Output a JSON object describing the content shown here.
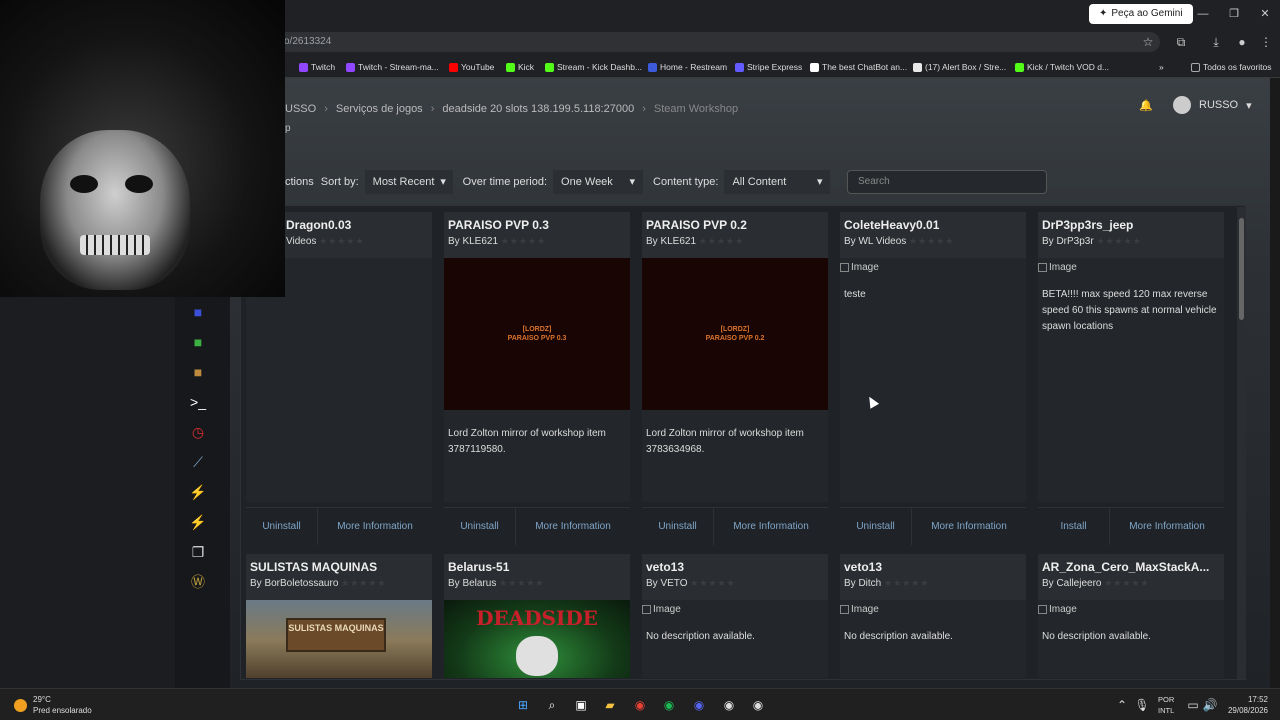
{
  "browser": {
    "gemini_button": "Peça ao Gemini",
    "address": "o/2613324",
    "bookmarks": [
      "Twitch",
      "Twitch - Stream-ma...",
      "YouTube",
      "Kick",
      "Stream - Kick Dashb...",
      "Home - Restream",
      "Stripe Express",
      "The best ChatBot an...",
      "(17) Alert Box / Stre...",
      "Kick / Twitch VOD d..."
    ],
    "bookmark_colors": [
      "#9146ff",
      "#9146ff",
      "#ff0000",
      "#53fc18",
      "#53fc18",
      "#3b5bdb",
      "#635bff",
      "#ffffff",
      "#e8e8e8",
      "#53fc18"
    ],
    "all_favorites": "Todos os favoritos",
    "chevron_more": "»"
  },
  "header": {
    "breadcrumb": [
      "USSO",
      "Serviços de jogos",
      "deadside 20 slots 138.199.5.118:27000",
      "Steam Workshop"
    ],
    "subtitle": "p",
    "user": "RUSSO"
  },
  "filters": {
    "lead": "ctions",
    "sort_label": "Sort by:",
    "sort_value": "Most Recent",
    "period_label": "Over time period:",
    "period_value": "One Week",
    "content_label": "Content type:",
    "content_value": "All Content",
    "search_placeholder": "Search"
  },
  "cards_row1": [
    {
      "title": "Dragon0.03",
      "by": "Videos",
      "desc": "",
      "primary": "Uninstall",
      "secondary": "More Information"
    },
    {
      "title": "PARAISO PVP 0.3",
      "by": "By KLE621",
      "thumb_line1": "[LORDZ]",
      "thumb_line2": "PARAISO PVP 0.3",
      "desc": "Lord Zolton mirror of workshop item 3787119580.",
      "primary": "Uninstall",
      "secondary": "More Information"
    },
    {
      "title": "PARAISO PVP 0.2",
      "by": "By KLE621",
      "thumb_line1": "[LORDZ]",
      "thumb_line2": "PARAISO PVP 0.2",
      "desc": "Lord Zolton mirror of workshop item 3783634968.",
      "primary": "Uninstall",
      "secondary": "More Information"
    },
    {
      "title": "ColeteHeavy0.01",
      "by": "By WL Videos",
      "img": "Image",
      "desc": "teste",
      "primary": "Uninstall",
      "secondary": "More Information"
    },
    {
      "title": "DrP3pp3rs_jeep",
      "by": "By DrP3p3r",
      "img": "Image",
      "desc": "BETA!!!! max speed 120 max reverse speed 60 this spawns at normal vehicle spawn locations",
      "primary": "Install",
      "secondary": "More Information"
    }
  ],
  "cards_row2": [
    {
      "title": "SULISTAS MAQUINAS",
      "by": "By BorBoletossauro"
    },
    {
      "title": "Belarus-51",
      "by": "By Belarus"
    },
    {
      "title": "veto13",
      "by": "By VETO",
      "img": "Image",
      "desc": "No description available."
    },
    {
      "title": "veto13",
      "by": "By Ditch",
      "img": "Image",
      "desc": "No description available."
    },
    {
      "title": "AR_Zona_Cero_MaxStackA...",
      "by": "By Callejeero",
      "img": "Image",
      "desc": "No description available."
    }
  ],
  "thumb_texts": {
    "sulistas": "SULISTAS MAQUINAS",
    "deadside": "DEADSIDE"
  },
  "stars": "★★★★★",
  "taskbar": {
    "temp": "29°C",
    "weather": "Pred ensolarado",
    "lang1": "POR",
    "lang2": "INTL",
    "time": "17:52",
    "date": "29/08/2026"
  }
}
